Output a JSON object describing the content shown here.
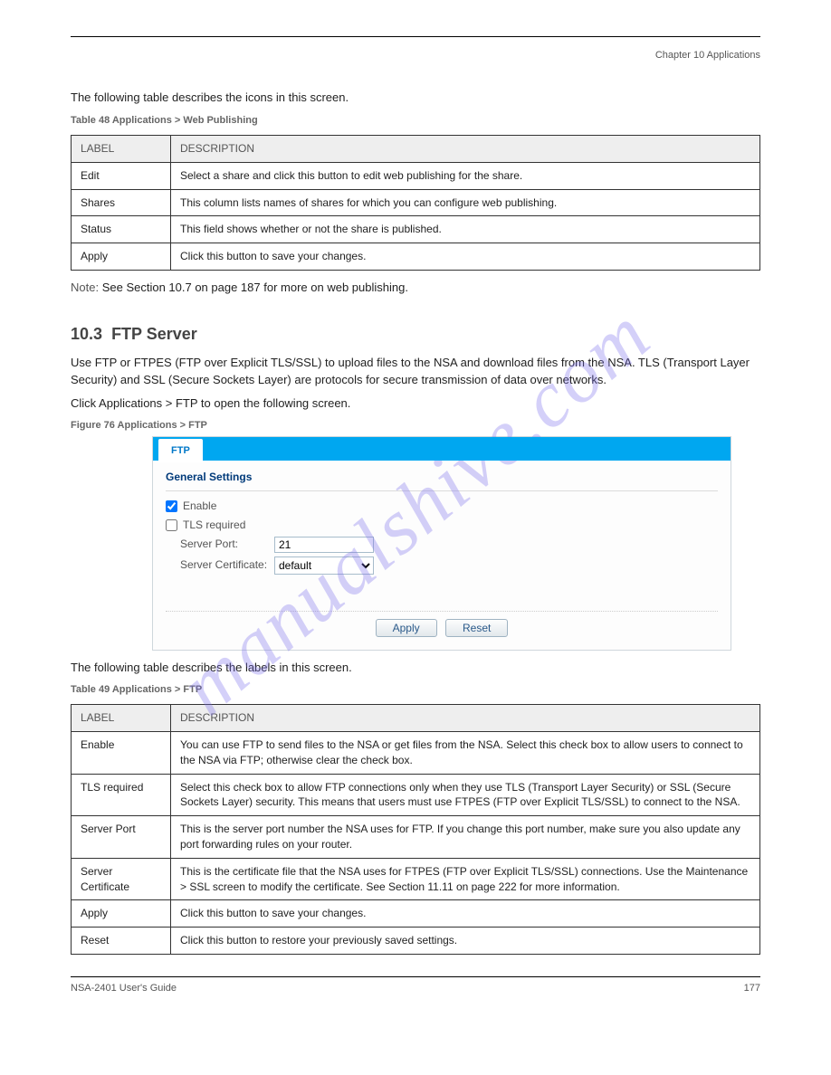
{
  "watermark": "manualshive.com",
  "header": {
    "chapter": "Chapter 10 Applications",
    "guide": "NSA-2401 User's Guide"
  },
  "footer": {
    "guide": "NSA-2401 User's Guide",
    "page": "177"
  },
  "intro": "The following table describes the icons in this screen.",
  "table1": {
    "caption": "Table 48   Applications > Web Publishing",
    "headers": [
      "LABEL",
      "DESCRIPTION"
    ],
    "rows": [
      [
        "Edit",
        "Select a share and click this button to edit web publishing for the share."
      ],
      [
        "Shares",
        "This column lists names of shares for which you can configure web publishing."
      ],
      [
        "Status",
        "This field shows whether or not the share is published."
      ],
      [
        "Apply",
        "Click this button to save your changes."
      ]
    ]
  },
  "note": {
    "label": "Note:",
    "text": "See Section 10.7 on page 187 for more on web publishing."
  },
  "section": {
    "number": "10.3",
    "title": "FTP Server",
    "body1": "Use FTP or FTPES (FTP over Explicit TLS/SSL) to upload files to the NSA and download files from the NSA. TLS (Transport Layer Security) and SSL (Secure Sockets Layer) are protocols for secure transmission of data over networks.",
    "figure_caption": "Figure 76   Applications > FTP",
    "click_text": "Click Applications > FTP to open the following screen.",
    "post_table_intro": "The following table describes the labels in this screen."
  },
  "ftp_panel": {
    "tab": "FTP",
    "section_title": "General Settings",
    "enable_label": "Enable",
    "enable_checked": true,
    "tls_label": "TLS required",
    "tls_checked": false,
    "server_port_label": "Server Port:",
    "server_port_value": "21",
    "server_cert_label": "Server Certificate:",
    "server_cert_value": "default",
    "apply": "Apply",
    "reset": "Reset"
  },
  "table2": {
    "caption": "Table 49   Applications > FTP",
    "headers": [
      "LABEL",
      "DESCRIPTION"
    ],
    "rows": [
      [
        "Enable",
        "You can use FTP to send files to the NSA or get files from the NSA. Select this check box to allow users to connect to the NSA via FTP; otherwise clear the check box."
      ],
      [
        "TLS required",
        "Select this check box to allow FTP connections only when they use TLS (Transport Layer Security) or SSL (Secure Sockets Layer) security. This means that users must use FTPES (FTP over Explicit TLS/SSL) to connect to the NSA."
      ],
      [
        "Server Port",
        "This is the server port number the NSA uses for FTP. If you change this port number, make sure you also update any port forwarding rules on your router."
      ],
      [
        "Server Certificate",
        "This is the certificate file that the NSA uses for FTPES (FTP over Explicit TLS/SSL) connections. Use the Maintenance > SSL screen to modify the certificate. See Section 11.11 on page 222 for more information."
      ],
      [
        "Apply",
        "Click this button to save your changes."
      ],
      [
        "Reset",
        "Click this button to restore your previously saved settings."
      ]
    ]
  }
}
